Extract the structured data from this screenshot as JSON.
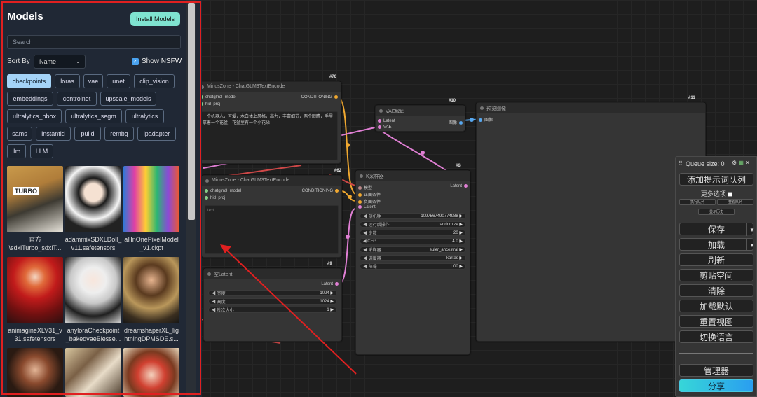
{
  "sidebar": {
    "title": "Models",
    "install_button": "Install Models",
    "search_placeholder": "Search",
    "sort_by_label": "Sort By",
    "sort_value": "Name",
    "show_nsfw_label": "Show NSFW",
    "show_nsfw_checked": true,
    "tags": [
      "checkpoints",
      "loras",
      "vae",
      "unet",
      "clip_vision",
      "embeddings",
      "controlnet",
      "upscale_models",
      "ultralytics_bbox",
      "ultralytics_segm",
      "ultralytics",
      "sams",
      "instantid",
      "pulid",
      "rembg",
      "ipadapter",
      "llm",
      "LLM"
    ],
    "active_tag": "checkpoints",
    "models": [
      {
        "caption_line1": "官方",
        "caption_line2": "\\sdxlTurbo_sdxlT..."
      },
      {
        "caption_line1": "adammixSDXLDoll_",
        "caption_line2": "v11.safetensors"
      },
      {
        "caption_line1": "allInOnePixelModel",
        "caption_line2": "_v1.ckpt"
      },
      {
        "caption_line1": "animagineXLV31_v",
        "caption_line2": "31.safetensors"
      },
      {
        "caption_line1": "anyloraCheckpoint",
        "caption_line2": "_bakedvaeBlesse..."
      },
      {
        "caption_line1": "dreamshaperXL_lig",
        "caption_line2": "htningDPMSDE.s..."
      },
      {
        "caption_line1": "",
        "caption_line2": ""
      },
      {
        "caption_line1": "",
        "caption_line2": ""
      },
      {
        "caption_line1": "",
        "caption_line2": ""
      }
    ],
    "turbo_overlay": "TURBO"
  },
  "nodes": {
    "n76": {
      "id": "#76",
      "title": "MinusZone - ChatGLM3TextEncode",
      "in1": "chatglm3_model",
      "in2": "hid_proj",
      "out1": "CONDITIONING",
      "text": "一个机器人，可爱，木白体上风格，高力，丰富细节，两个眼睛，手里拿着一个花盆，花盆里有一个小花朵"
    },
    "n62": {
      "id": "#62",
      "title": "MinusZone - ChatGLM3TextEncode",
      "in1": "chatglm3_model",
      "in2": "hid_proj",
      "out1": "CONDITIONING",
      "text": "text"
    },
    "n10": {
      "id": "#10",
      "title": "VAE解码",
      "in1": "Latent",
      "in2": "VAE",
      "out1": "图像"
    },
    "n11": {
      "id": "#11",
      "title": "预览图像",
      "in1": "图像"
    },
    "n6": {
      "id": "#6",
      "title": "K采样器",
      "in1": "模型",
      "in2": "正面条件",
      "in3": "负面条件",
      "in4": "Latent",
      "out1": "Latent",
      "widgets": [
        {
          "label": "随机种",
          "value": "1097567490774988"
        },
        {
          "label": "运行后操作",
          "value": "randomize"
        },
        {
          "label": "步数",
          "value": "20"
        },
        {
          "label": "CFG",
          "value": "4.0"
        },
        {
          "label": "采样器",
          "value": "euler_ancestral"
        },
        {
          "label": "调度器",
          "value": "karras"
        },
        {
          "label": "降噪",
          "value": "1.00"
        }
      ]
    },
    "n9": {
      "id": "#9",
      "title": "空Latent",
      "out1": "Latent",
      "widgets": [
        {
          "label": "宽度",
          "value": "1024"
        },
        {
          "label": "高度",
          "value": "1024"
        },
        {
          "label": "批次大小",
          "value": "1"
        }
      ]
    }
  },
  "queue": {
    "title": "Queue size: 0",
    "icons": [
      "gear-icon",
      "image-icon",
      "close-icon"
    ],
    "add_prompt": "添加提示词队列",
    "more_options": "更多选项",
    "exec_queue": "执行队列",
    "view_queue": "查看队列",
    "view_history": "显示历史",
    "save": "保存",
    "load": "加载",
    "refresh": "刷新",
    "clipspace": "剪贴空间",
    "clear": "清除",
    "load_default": "加载默认",
    "reset_view": "重置视图",
    "switch_lang": "切换语言",
    "manager": "管理器",
    "share": "分享"
  },
  "colors": {
    "accent_teal": "#7fe3d0",
    "tag_active": "#a4d3f7",
    "annotation_red": "#e02020",
    "wire_pink": "#e07fd4",
    "wire_orange": "#f0a830",
    "wire_red": "#d04848",
    "wire_blue": "#58a8f0"
  }
}
